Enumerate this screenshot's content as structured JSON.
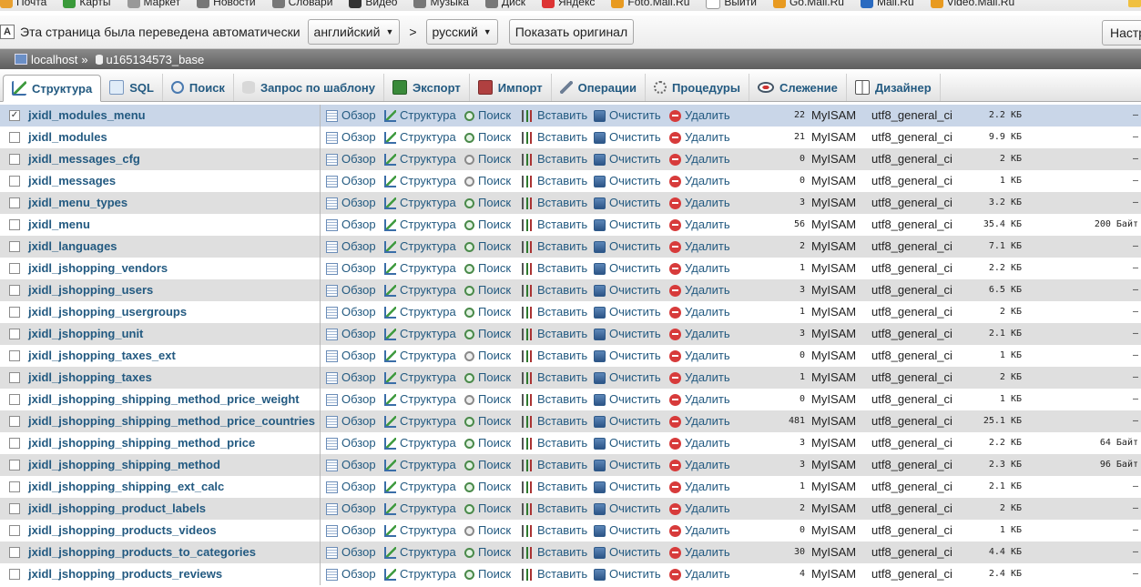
{
  "bookmarks": [
    "Почта",
    "Карты",
    "Маркет",
    "Новости",
    "Словари",
    "Видео",
    "Музыка",
    "Диск",
    "Яндекс",
    "Foto.Mail.Ru",
    "Выйти",
    "Go.Mail.Ru",
    "Mail.Ru",
    "Video.Mail.Ru"
  ],
  "translate_bar": {
    "message": "Эта страница была переведена автоматически",
    "from_lang": "английский",
    "arrow": ">",
    "to_lang": "русский",
    "show_original": "Показать оригинал",
    "settings": "Настр"
  },
  "breadcrumb": {
    "server": "localhost",
    "separator": "»",
    "database": "u165134573_base"
  },
  "tabs": [
    {
      "label": "Структура",
      "active": true
    },
    {
      "label": "SQL"
    },
    {
      "label": "Поиск"
    },
    {
      "label": "Запрос по шаблону"
    },
    {
      "label": "Экспорт"
    },
    {
      "label": "Импорт"
    },
    {
      "label": "Операции"
    },
    {
      "label": "Процедуры"
    },
    {
      "label": "Слежение"
    },
    {
      "label": "Дизайнер"
    }
  ],
  "actions": {
    "browse": "Обзор",
    "structure": "Структура",
    "search": "Поиск",
    "insert": "Вставить",
    "empty": "Очистить",
    "drop": "Удалить"
  },
  "checked_mark": "✓",
  "tables": [
    {
      "name": "jxidl_modules_menu",
      "rows": "22",
      "engine": "MyISAM",
      "collation": "utf8_general_ci",
      "size": "2.2 КБ",
      "overhead": "–",
      "checked": true
    },
    {
      "name": "jxidl_modules",
      "rows": "21",
      "engine": "MyISAM",
      "collation": "utf8_general_ci",
      "size": "9.9 КБ",
      "overhead": "–"
    },
    {
      "name": "jxidl_messages_cfg",
      "rows": "0",
      "engine": "MyISAM",
      "collation": "utf8_general_ci",
      "size": "2 КБ",
      "overhead": "–"
    },
    {
      "name": "jxidl_messages",
      "rows": "0",
      "engine": "MyISAM",
      "collation": "utf8_general_ci",
      "size": "1 КБ",
      "overhead": "–"
    },
    {
      "name": "jxidl_menu_types",
      "rows": "3",
      "engine": "MyISAM",
      "collation": "utf8_general_ci",
      "size": "3.2 КБ",
      "overhead": "–"
    },
    {
      "name": "jxidl_menu",
      "rows": "56",
      "engine": "MyISAM",
      "collation": "utf8_general_ci",
      "size": "35.4 КБ",
      "overhead": "200 Байт"
    },
    {
      "name": "jxidl_languages",
      "rows": "2",
      "engine": "MyISAM",
      "collation": "utf8_general_ci",
      "size": "7.1 КБ",
      "overhead": "–"
    },
    {
      "name": "jxidl_jshopping_vendors",
      "rows": "1",
      "engine": "MyISAM",
      "collation": "utf8_general_ci",
      "size": "2.2 КБ",
      "overhead": "–"
    },
    {
      "name": "jxidl_jshopping_users",
      "rows": "3",
      "engine": "MyISAM",
      "collation": "utf8_general_ci",
      "size": "6.5 КБ",
      "overhead": "–"
    },
    {
      "name": "jxidl_jshopping_usergroups",
      "rows": "1",
      "engine": "MyISAM",
      "collation": "utf8_general_ci",
      "size": "2 КБ",
      "overhead": "–"
    },
    {
      "name": "jxidl_jshopping_unit",
      "rows": "3",
      "engine": "MyISAM",
      "collation": "utf8_general_ci",
      "size": "2.1 КБ",
      "overhead": "–"
    },
    {
      "name": "jxidl_jshopping_taxes_ext",
      "rows": "0",
      "engine": "MyISAM",
      "collation": "utf8_general_ci",
      "size": "1 КБ",
      "overhead": "–"
    },
    {
      "name": "jxidl_jshopping_taxes",
      "rows": "1",
      "engine": "MyISAM",
      "collation": "utf8_general_ci",
      "size": "2 КБ",
      "overhead": "–"
    },
    {
      "name": "jxidl_jshopping_shipping_method_price_weight",
      "rows": "0",
      "engine": "MyISAM",
      "collation": "utf8_general_ci",
      "size": "1 КБ",
      "overhead": "–"
    },
    {
      "name": "jxidl_jshopping_shipping_method_price_countries",
      "rows": "481",
      "engine": "MyISAM",
      "collation": "utf8_general_ci",
      "size": "25.1 КБ",
      "overhead": "–"
    },
    {
      "name": "jxidl_jshopping_shipping_method_price",
      "rows": "3",
      "engine": "MyISAM",
      "collation": "utf8_general_ci",
      "size": "2.2 КБ",
      "overhead": "64 Байт"
    },
    {
      "name": "jxidl_jshopping_shipping_method",
      "rows": "3",
      "engine": "MyISAM",
      "collation": "utf8_general_ci",
      "size": "2.3 КБ",
      "overhead": "96 Байт"
    },
    {
      "name": "jxidl_jshopping_shipping_ext_calc",
      "rows": "1",
      "engine": "MyISAM",
      "collation": "utf8_general_ci",
      "size": "2.1 КБ",
      "overhead": "–"
    },
    {
      "name": "jxidl_jshopping_product_labels",
      "rows": "2",
      "engine": "MyISAM",
      "collation": "utf8_general_ci",
      "size": "2 КБ",
      "overhead": "–"
    },
    {
      "name": "jxidl_jshopping_products_videos",
      "rows": "0",
      "engine": "MyISAM",
      "collation": "utf8_general_ci",
      "size": "1 КБ",
      "overhead": "–"
    },
    {
      "name": "jxidl_jshopping_products_to_categories",
      "rows": "30",
      "engine": "MyISAM",
      "collation": "utf8_general_ci",
      "size": "4.4 КБ",
      "overhead": "–"
    },
    {
      "name": "jxidl_jshopping_products_reviews",
      "rows": "4",
      "engine": "MyISAM",
      "collation": "utf8_general_ci",
      "size": "2.4 КБ",
      "overhead": "–"
    }
  ]
}
